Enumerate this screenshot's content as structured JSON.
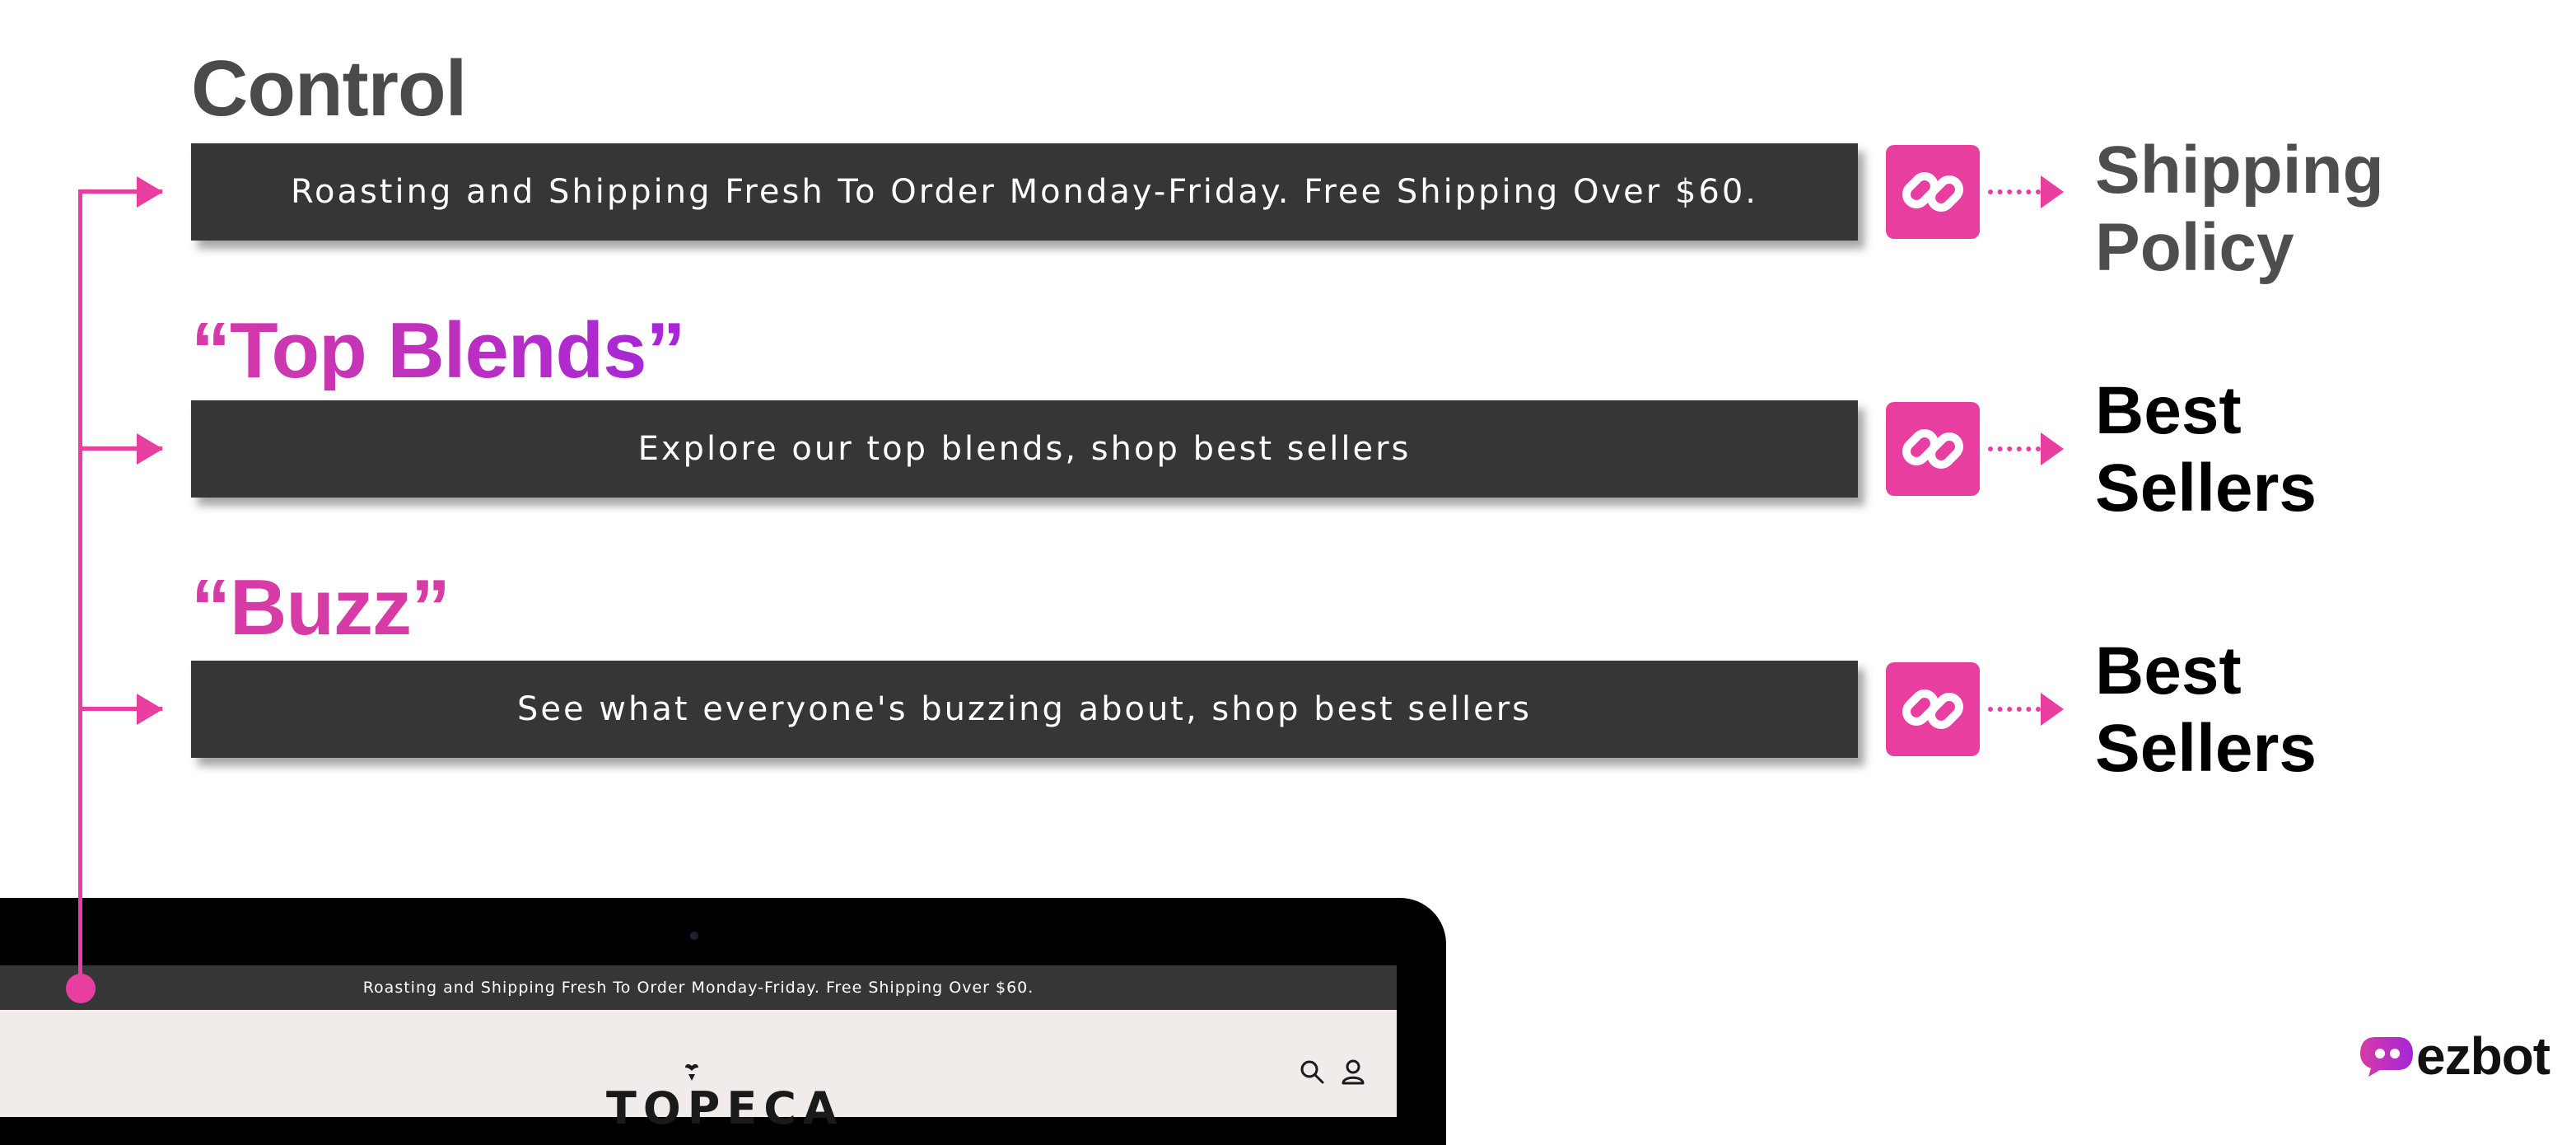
{
  "variants": [
    {
      "heading": "Control",
      "banner_text": "Roasting and Shipping Fresh To Order Monday-Friday. Free Shipping Over $60.",
      "destination_line1": "Shipping",
      "destination_line2": "Policy"
    },
    {
      "heading": "“Top Blends”",
      "banner_text": "Explore our top blends, shop best sellers",
      "destination_line1": "Best",
      "destination_line2": "Sellers"
    },
    {
      "heading": "“Buzz”",
      "banner_text": "See what everyone's buzzing about, shop best sellers",
      "destination_line1": "Best",
      "destination_line2": "Sellers"
    }
  ],
  "laptop": {
    "announcement_bar": "Roasting and Shipping Fresh To Order Monday-Friday. Free Shipping Over $60.",
    "brand_name": "TOPECA"
  },
  "logo": {
    "text": "ezbot"
  },
  "icons": [
    "link-icon",
    "search-icon",
    "user-icon",
    "leaf-icon",
    "ezbot-logo-icon"
  ],
  "colors": {
    "accent": "#e83ea0",
    "gradient_start": "#d63ba6",
    "gradient_end": "#a526d8",
    "banner": "#363636",
    "control_heading": "#4a4a4a",
    "screen_bg": "#f1ecea"
  }
}
